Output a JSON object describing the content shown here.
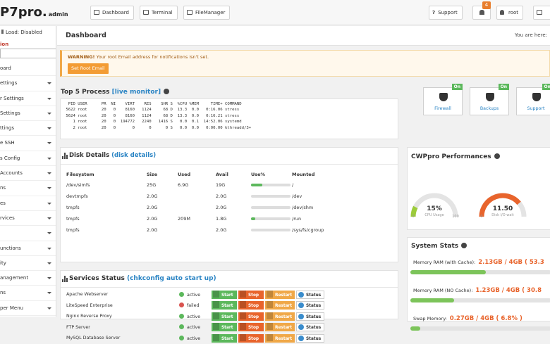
{
  "topbar": {
    "logo_main": "P7pro.",
    "logo_sub": "admin",
    "tabs": [
      {
        "label": "Dashboard",
        "icon": "dashboard-icon"
      },
      {
        "label": "Terminal",
        "icon": "terminal-icon"
      },
      {
        "label": "FileManager",
        "icon": "folder-icon"
      }
    ],
    "support_label": "Support",
    "notifications_count": "4",
    "user_label": "root"
  },
  "sidebar": {
    "load": "Load: Disabled",
    "heading": "ion",
    "items": [
      {
        "label": "oard",
        "caret": false
      },
      {
        "label": "ettings",
        "caret": true
      },
      {
        "label": "r Settings",
        "caret": true
      },
      {
        "label": "Settings",
        "caret": true
      },
      {
        "label": "ttings",
        "caret": true
      },
      {
        "label": "e SSH",
        "caret": true
      },
      {
        "label": "s Config",
        "caret": true
      },
      {
        "label": "Accounts",
        "caret": true
      },
      {
        "label": "ns",
        "caret": true
      },
      {
        "label": "es",
        "caret": true
      },
      {
        "label": "rvices",
        "caret": true
      },
      {
        "label": "",
        "caret": true
      },
      {
        "label": "unctions",
        "caret": true
      },
      {
        "label": "ity",
        "caret": true
      },
      {
        "label": "anagement",
        "caret": true
      },
      {
        "label": "ns",
        "caret": true
      },
      {
        "label": "per Menu",
        "caret": true
      }
    ]
  },
  "main": {
    "title": "Dashboard",
    "you_are_here": "You are here:",
    "warning_bold": "WARNING!",
    "warning_text": " Your root Email address for notifications isn't set.",
    "set_email_button": "Set Root Email",
    "top_process_title": "Top 5 Process ",
    "top_process_link": "[live monitor]",
    "process_header": "  PID USER      PR  NI    VIRT    RES    SHR S  %CPU %MEM     TIME+ COMMAND",
    "processes": [
      " 5622 root      20   0    8160   1124     68 D  13.3  0.0   0:16.06 stress",
      " 5624 root      20   0    8160   1124     68 D  13.3  0.0   0:16.21 stress",
      "    1 root      20   0  194772   2240   1416 S   0.0  0.1  14:52.06 systemd",
      "    2 root      20   0       0      0      0 S   0.0  0.0   0:00.00 kthreadd/3+"
    ],
    "disk_title": "Disk Details ",
    "disk_link": "(disk details)",
    "disk_columns": [
      "Filesystem",
      "Size",
      "Used",
      "Avail",
      "Use%",
      "Mounted"
    ],
    "disks": [
      {
        "fs": "/dev/simfs",
        "size": "25G",
        "used": "6.9G",
        "avail": "19G",
        "pct": 0.28,
        "mount": "/"
      },
      {
        "fs": "devtmpfs",
        "size": "2.0G",
        "used": "",
        "avail": "2.0G",
        "pct": 0,
        "mount": "/dev"
      },
      {
        "fs": "tmpfs",
        "size": "2.0G",
        "used": "",
        "avail": "2.0G",
        "pct": 0,
        "mount": "/dev/shm"
      },
      {
        "fs": "tmpfs",
        "size": "2.0G",
        "used": "209M",
        "avail": "1.8G",
        "pct": 0.1,
        "mount": "/run"
      },
      {
        "fs": "tmpfs",
        "size": "2.0G",
        "used": "",
        "avail": "2.0G",
        "pct": 0,
        "mount": "/sys/fs/cgroup"
      }
    ],
    "services_title": "Services Status ",
    "services_link": "(chkconfig auto start up)",
    "services": [
      {
        "name": "Apache Webserver",
        "status": "active",
        "state": "ok"
      },
      {
        "name": "LiteSpeed Enterprise",
        "status": "failed",
        "state": "fail"
      },
      {
        "name": "Nginx Reverse Proxy",
        "status": "active",
        "state": "ok"
      },
      {
        "name": "FTP Server",
        "status": "active",
        "state": "ok"
      },
      {
        "name": "MySQL Database Server",
        "status": "active",
        "state": "ok"
      }
    ],
    "service_buttons": {
      "start": "Start",
      "stop": "Stop",
      "restart": "Restart",
      "status": "Status"
    },
    "service_colors": {
      "start": "#5cb85c",
      "stop": "#e8642c",
      "restart": "#f0a848",
      "status": "#3a8ccc"
    }
  },
  "right": {
    "features": [
      {
        "label": "Firewall",
        "badge": "On",
        "icon": "shield-icon"
      },
      {
        "label": "Backups",
        "badge": "On",
        "icon": "backup-icon"
      },
      {
        "label": "Support",
        "badge": "Onli",
        "icon": "lifebuoy-icon"
      }
    ],
    "perf_title": "CWPpro Performances",
    "gauges": [
      {
        "value": "15%",
        "label": "CPU Usage",
        "min": "0",
        "max": "100",
        "fraction": 0.15,
        "color": "#9ccc3a"
      },
      {
        "value": "11.50",
        "label": "Disk I/O wait",
        "min": "0",
        "max": "",
        "fraction": 0.78,
        "color": "#e8642c"
      }
    ],
    "stats_title": "System Stats",
    "stats": [
      {
        "label": "Memory RAM (with Cache):",
        "value": "2.13GB / 4GB ( 53.3",
        "fraction": 0.533
      },
      {
        "label": "Memory RAM (NO Cache):",
        "value": "1.23GB / 4GB ( 30.8",
        "fraction": 0.308
      },
      {
        "label": "Swap Memory:",
        "value": "0.27GB / 4GB ( 6.8% )",
        "fraction": 0.068
      }
    ]
  }
}
